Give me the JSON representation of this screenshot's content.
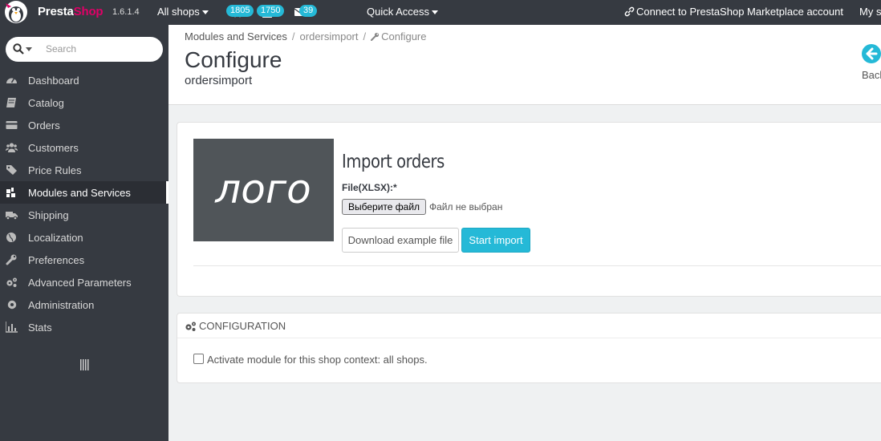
{
  "topbar": {
    "brand_presta": "Presta",
    "brand_shop": "Shop",
    "version": "1.6.1.4",
    "all_shops": "All shops",
    "badges": {
      "orders": "1805",
      "customers": "1750",
      "messages": "39"
    },
    "quick_access": "Quick Access",
    "connect": "Connect to PrestaShop Marketplace account",
    "my_shop": "My s",
    "accent": "#25b9d7",
    "brand_pink": "#df0067"
  },
  "sidebar": {
    "search_placeholder": "Search",
    "items": [
      {
        "label": "Dashboard",
        "icon": "dashboard-icon"
      },
      {
        "label": "Catalog",
        "icon": "book-icon"
      },
      {
        "label": "Orders",
        "icon": "credit-card-icon"
      },
      {
        "label": "Customers",
        "icon": "users-icon"
      },
      {
        "label": "Price Rules",
        "icon": "tags-icon"
      },
      {
        "label": "Modules and Services",
        "icon": "puzzle-icon",
        "active": true
      },
      {
        "label": "Shipping",
        "icon": "truck-icon"
      },
      {
        "label": "Localization",
        "icon": "globe-icon"
      },
      {
        "label": "Preferences",
        "icon": "wrench-icon"
      },
      {
        "label": "Advanced Parameters",
        "icon": "cogs-icon"
      },
      {
        "label": "Administration",
        "icon": "gear-icon"
      },
      {
        "label": "Stats",
        "icon": "bar-chart-icon"
      }
    ]
  },
  "header": {
    "breadcrumb": [
      "Modules and Services",
      "ordersimport",
      "Configure"
    ],
    "title": "Configure",
    "subtitle": "ordersimport",
    "back_label": "Back"
  },
  "import_panel": {
    "logo_text": "лого",
    "title": "Import orders",
    "file_label": "File(XLSX):*",
    "file_button": "Выберите файл",
    "file_status": "Файл не выбран",
    "download_button": "Download example file",
    "start_button": "Start import"
  },
  "config_panel": {
    "heading": "Configuration",
    "checkbox_label": "Activate module for this shop context: all shops."
  }
}
